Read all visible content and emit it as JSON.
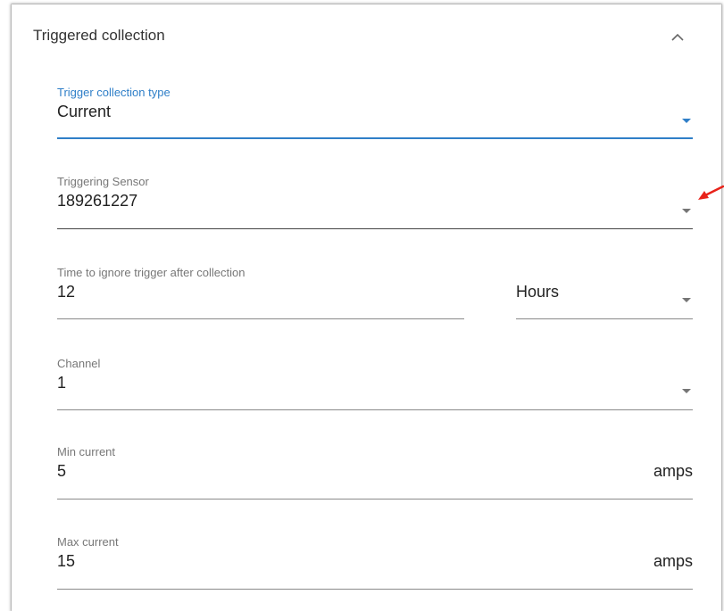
{
  "panel": {
    "title": "Triggered collection",
    "collapse_icon": "chevron-up-icon"
  },
  "fields": {
    "trigger_type": {
      "label": "Trigger collection type",
      "value": "Current",
      "icon": "dropdown-arrow-icon"
    },
    "triggering_sensor": {
      "label": "Triggering Sensor",
      "value": "189261227",
      "icon": "dropdown-arrow-icon"
    },
    "ignore_time": {
      "label": "Time to ignore trigger after collection",
      "value": "12",
      "unit_value": "Hours",
      "icon": "dropdown-arrow-icon"
    },
    "channel": {
      "label": "Channel",
      "value": "1",
      "icon": "dropdown-arrow-icon"
    },
    "min_current": {
      "label": "Min current",
      "value": "5",
      "unit": "amps"
    },
    "max_current": {
      "label": "Max current",
      "value": "15",
      "unit": "amps"
    }
  },
  "colors": {
    "accent": "#2f7fc8",
    "annotation": "#e8231a"
  }
}
